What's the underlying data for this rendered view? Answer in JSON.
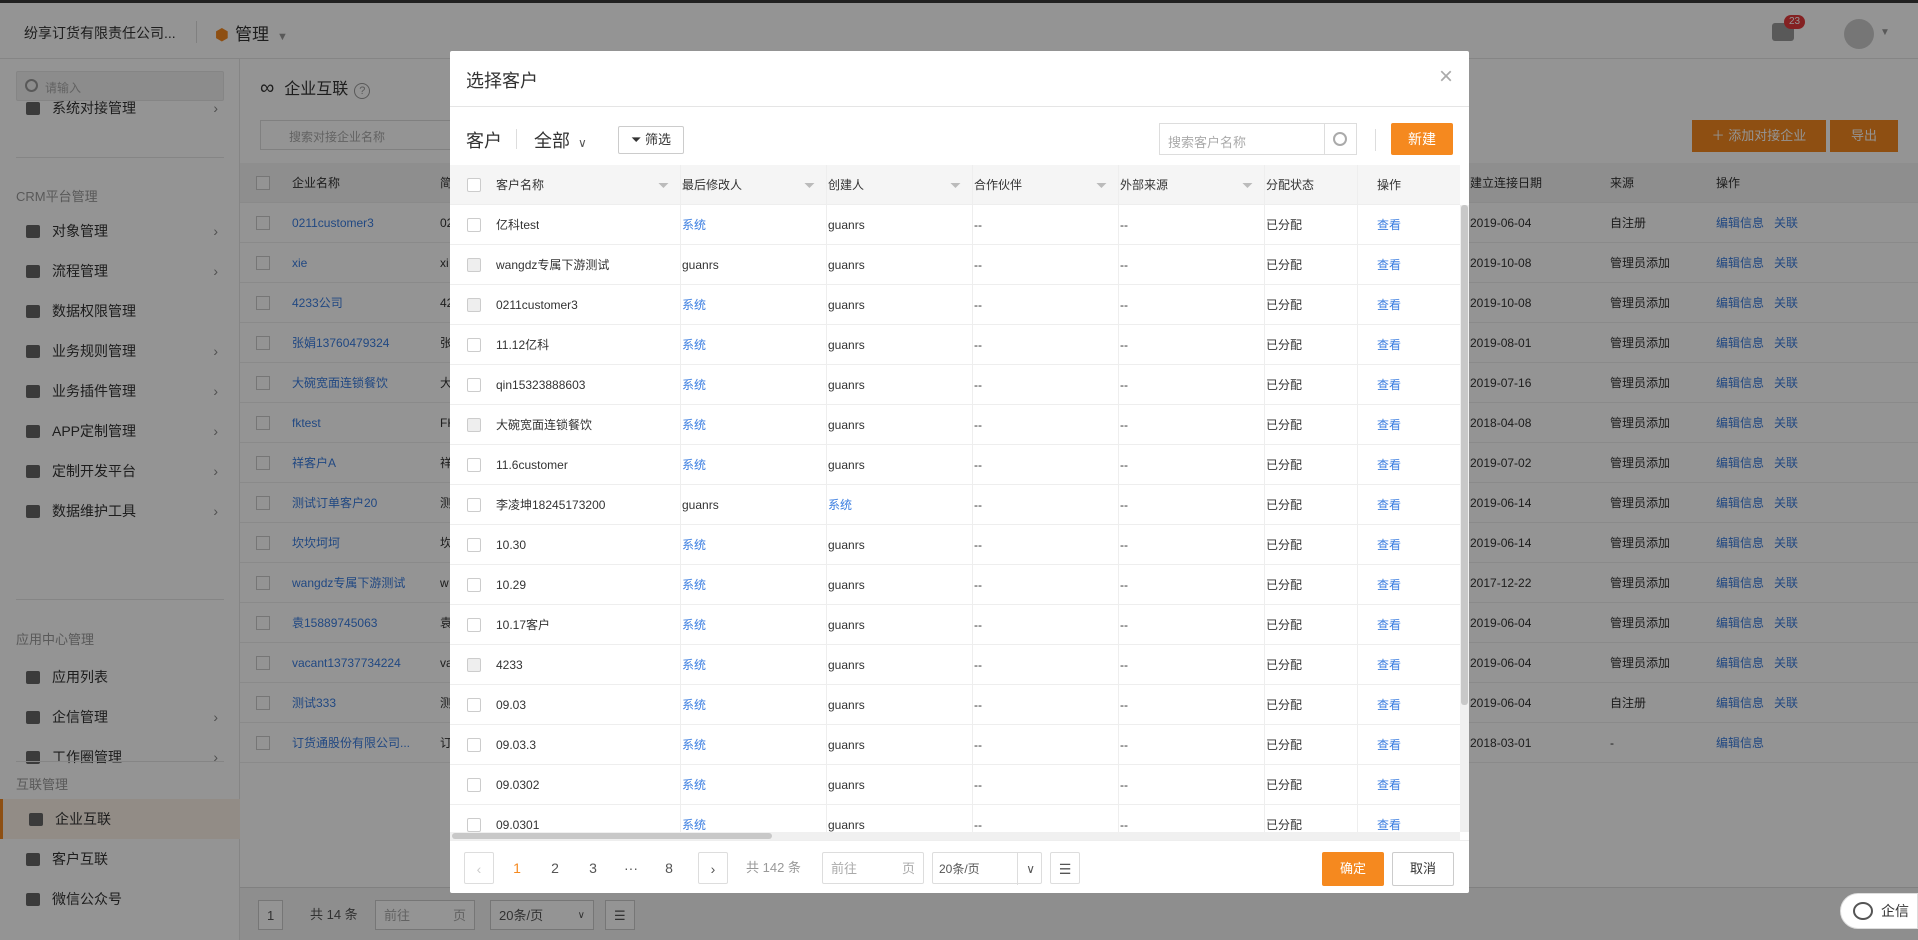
{
  "topbar": {
    "company": "纷享订货有限责任公司...",
    "module": "管理",
    "notif_count": "23"
  },
  "sidebar": {
    "search_placeholder": "请输入",
    "item_top": "系统对接管理",
    "group_crm": "CRM平台管理",
    "crm_items": [
      "对象管理",
      "流程管理",
      "数据权限管理",
      "业务规则管理",
      "业务插件管理",
      "APP定制管理",
      "定制开发平台",
      "数据维护工具"
    ],
    "group_app": "应用中心管理",
    "app_items": [
      "应用列表",
      "企信管理",
      "工作圈管理"
    ],
    "group_link": "互联管理",
    "link_items": [
      "企业互联",
      "客户互联",
      "微信公众号"
    ]
  },
  "main": {
    "title": "企业互联",
    "search_placeholder": "搜索对接企业名称",
    "add_button": "添加对接企业",
    "export_button": "导出",
    "headers": [
      "企业名称",
      "简",
      "建立连接日期",
      "来源",
      "操作"
    ],
    "rows": [
      {
        "name": "0211customer3",
        "abbr": "02",
        "date": "2019-06-04",
        "src": "自注册",
        "ops": [
          "编辑信息",
          "关联"
        ]
      },
      {
        "name": "xie",
        "abbr": "xi",
        "date": "2019-10-08",
        "src": "管理员添加",
        "ops": [
          "编辑信息",
          "关联"
        ]
      },
      {
        "name": "4233公司",
        "abbr": "42",
        "date": "2019-10-08",
        "src": "管理员添加",
        "ops": [
          "编辑信息",
          "关联"
        ]
      },
      {
        "name": "张娟13760479324",
        "abbr": "张",
        "date": "2019-08-01",
        "src": "管理员添加",
        "ops": [
          "编辑信息",
          "关联"
        ]
      },
      {
        "name": "大碗宽面连锁餐饮",
        "abbr": "大",
        "date": "2019-07-16",
        "src": "管理员添加",
        "ops": [
          "编辑信息",
          "关联"
        ]
      },
      {
        "name": "fktest",
        "abbr": "FK",
        "date": "2018-04-08",
        "src": "管理员添加",
        "ops": [
          "编辑信息",
          "关联"
        ]
      },
      {
        "name": "祥客户A",
        "abbr": "祥",
        "date": "2019-07-02",
        "src": "管理员添加",
        "ops": [
          "编辑信息",
          "关联"
        ]
      },
      {
        "name": "测试订单客户20",
        "abbr": "测",
        "date": "2019-06-14",
        "src": "管理员添加",
        "ops": [
          "编辑信息",
          "关联"
        ]
      },
      {
        "name": "坎坎坷坷",
        "abbr": "坎",
        "date": "2019-06-14",
        "src": "管理员添加",
        "ops": [
          "编辑信息",
          "关联"
        ]
      },
      {
        "name": "wangdz专属下游测试",
        "abbr": "w",
        "date": "2017-12-22",
        "src": "管理员添加",
        "ops": [
          "编辑信息",
          "关联"
        ]
      },
      {
        "name": "袁15889745063",
        "abbr": "袁",
        "date": "2019-06-04",
        "src": "管理员添加",
        "ops": [
          "编辑信息",
          "关联"
        ]
      },
      {
        "name": "vacant13737734224",
        "abbr": "va",
        "date": "2019-06-04",
        "src": "管理员添加",
        "ops": [
          "编辑信息",
          "关联"
        ]
      },
      {
        "name": "测试333",
        "abbr": "测",
        "date": "2019-06-04",
        "src": "自注册",
        "ops": [
          "编辑信息",
          "关联"
        ]
      },
      {
        "name": "订货通股份有限公司...",
        "abbr": "订",
        "date": "2018-03-01",
        "src": "-",
        "ops": [
          "编辑信息",
          ""
        ]
      }
    ],
    "pager": {
      "page": "1",
      "total": "共 14 条",
      "goto": "前往",
      "goto_unit": "页",
      "size": "20条/页"
    }
  },
  "modal": {
    "title": "选择客户",
    "object_label": "客户",
    "scope": "全部",
    "filter_button": "筛选",
    "search_placeholder": "搜索客户名称",
    "new_button": "新建",
    "headers": [
      "客户名称",
      "最后修改人",
      "创建人",
      "合作伙伴",
      "外部来源",
      "分配状态",
      "操作"
    ],
    "rows": [
      {
        "name": "亿科test",
        "modifier": "系统",
        "creator": "guanrs",
        "partner": "--",
        "ext": "--",
        "status": "已分配",
        "op": "查看",
        "dis": false
      },
      {
        "name": "wangdz专属下游测试",
        "modifier": "guanrs",
        "creator": "guanrs",
        "partner": "--",
        "ext": "--",
        "status": "已分配",
        "op": "查看",
        "dis": true
      },
      {
        "name": "0211customer3",
        "modifier": "系统",
        "creator": "guanrs",
        "partner": "--",
        "ext": "--",
        "status": "已分配",
        "op": "查看",
        "dis": true
      },
      {
        "name": "11.12亿科",
        "modifier": "系统",
        "creator": "guanrs",
        "partner": "--",
        "ext": "--",
        "status": "已分配",
        "op": "查看",
        "dis": false
      },
      {
        "name": "qin15323888603",
        "modifier": "系统",
        "creator": "guanrs",
        "partner": "--",
        "ext": "--",
        "status": "已分配",
        "op": "查看",
        "dis": false
      },
      {
        "name": "大碗宽面连锁餐饮",
        "modifier": "系统",
        "creator": "guanrs",
        "partner": "--",
        "ext": "--",
        "status": "已分配",
        "op": "查看",
        "dis": true
      },
      {
        "name": "11.6customer",
        "modifier": "系统",
        "creator": "guanrs",
        "partner": "--",
        "ext": "--",
        "status": "已分配",
        "op": "查看",
        "dis": false
      },
      {
        "name": "李凌坤18245173200",
        "modifier": "guanrs",
        "creator": "系统",
        "partner": "--",
        "ext": "--",
        "status": "已分配",
        "op": "查看",
        "dis": false
      },
      {
        "name": "10.30",
        "modifier": "系统",
        "creator": "guanrs",
        "partner": "--",
        "ext": "--",
        "status": "已分配",
        "op": "查看",
        "dis": false
      },
      {
        "name": "10.29",
        "modifier": "系统",
        "creator": "guanrs",
        "partner": "--",
        "ext": "--",
        "status": "已分配",
        "op": "查看",
        "dis": false
      },
      {
        "name": "10.17客户",
        "modifier": "系统",
        "creator": "guanrs",
        "partner": "--",
        "ext": "--",
        "status": "已分配",
        "op": "查看",
        "dis": false
      },
      {
        "name": "4233",
        "modifier": "系统",
        "creator": "guanrs",
        "partner": "--",
        "ext": "--",
        "status": "已分配",
        "op": "查看",
        "dis": true
      },
      {
        "name": "09.03",
        "modifier": "系统",
        "creator": "guanrs",
        "partner": "--",
        "ext": "--",
        "status": "已分配",
        "op": "查看",
        "dis": false
      },
      {
        "name": "09.03.3",
        "modifier": "系统",
        "creator": "guanrs",
        "partner": "--",
        "ext": "--",
        "status": "已分配",
        "op": "查看",
        "dis": false
      },
      {
        "name": "09.0302",
        "modifier": "系统",
        "creator": "guanrs",
        "partner": "--",
        "ext": "--",
        "status": "已分配",
        "op": "查看",
        "dis": false
      },
      {
        "name": "09.0301",
        "modifier": "系统",
        "creator": "guanrs",
        "partner": "--",
        "ext": "--",
        "status": "已分配",
        "op": "查看",
        "dis": false
      }
    ],
    "pager": {
      "pages": [
        "1",
        "2",
        "3",
        "···",
        "8"
      ],
      "current": "1",
      "total": "共 142 条",
      "goto": "前往",
      "goto_unit": "页",
      "size": "20条/页"
    },
    "ok_button": "确定",
    "cancel_button": "取消"
  },
  "chat_widget": "企信"
}
